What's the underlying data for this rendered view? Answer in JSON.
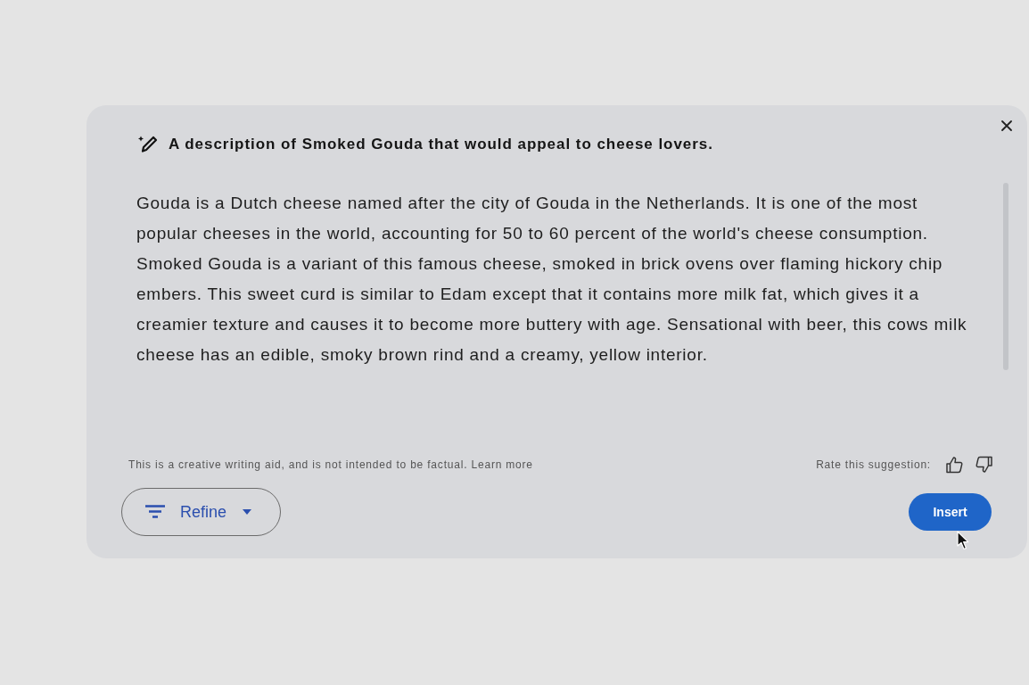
{
  "dialog": {
    "prompt": "A description of Smoked Gouda that would appeal to cheese lovers.",
    "response": "Gouda is a Dutch cheese named after the city of Gouda in the Netherlands. It is one of the most popular cheeses in the world, accounting for 50 to 60 percent of the world's cheese consumption. Smoked Gouda is a variant of this famous cheese, smoked in brick ovens over flaming hickory chip embers. This sweet curd is similar to Edam except that it contains more milk fat, which gives it a creamier texture and causes it to become more buttery with age. Sensational with beer, this cows milk cheese has an edible, smoky brown rind and a creamy, yellow interior.",
    "disclaimer": {
      "text": "This is a creative writing aid, and is not intended to be factual.",
      "link": "Learn more"
    },
    "rating": {
      "label": "Rate this suggestion:"
    },
    "refine_button": {
      "label": "Refine"
    },
    "insert_button": {
      "label": "Insert"
    }
  }
}
